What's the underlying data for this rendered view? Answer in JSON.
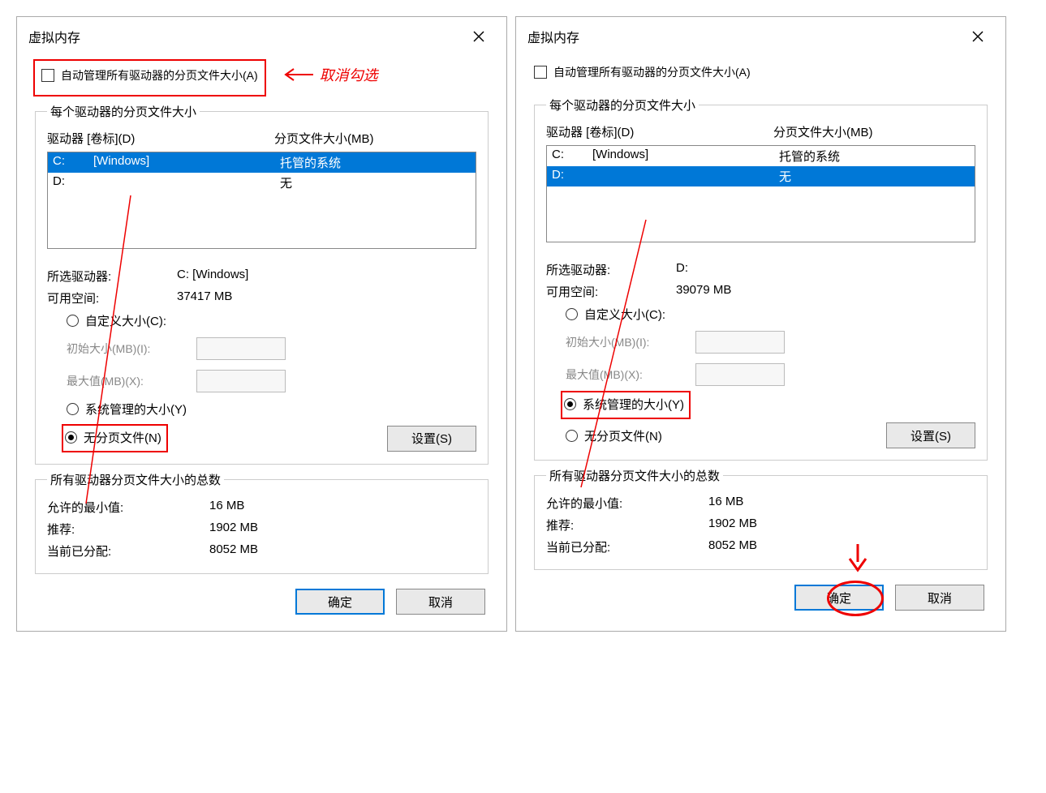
{
  "dialogs": [
    {
      "title": "虚拟内存",
      "auto_manage_label": "自动管理所有驱动器的分页文件大小(A)",
      "annot_uncheck": "取消勾选",
      "group1_legend": "每个驱动器的分页文件大小",
      "col_drive": "驱动器 [卷标](D)",
      "col_size": "分页文件大小(MB)",
      "drives": [
        {
          "letter": "C:",
          "label": "[Windows]",
          "size": "托管的系统",
          "selected": true
        },
        {
          "letter": "D:",
          "label": "",
          "size": "无",
          "selected": false
        }
      ],
      "sel_drive_label": "所选驱动器:",
      "sel_drive_value": "C:  [Windows]",
      "free_space_label": "可用空间:",
      "free_space_value": "37417 MB",
      "radio_custom": "自定义大小(C):",
      "initial_label": "初始大小(MB)(I):",
      "max_label": "最大值(MB)(X):",
      "radio_system": "系统管理的大小(Y)",
      "radio_none": "无分页文件(N)",
      "selected_radio": "none",
      "set_btn": "设置(S)",
      "group2_legend": "所有驱动器分页文件大小的总数",
      "min_label": "允许的最小值:",
      "min_value": "16 MB",
      "rec_label": "推荐:",
      "rec_value": "1902 MB",
      "cur_label": "当前已分配:",
      "cur_value": "8052 MB",
      "ok_btn": "确定",
      "cancel_btn": "取消",
      "highlight_checkbox": true,
      "highlight_none_radio": true,
      "highlight_system_radio": false,
      "circle_ok": false,
      "arrow_to_ok": false
    },
    {
      "title": "虚拟内存",
      "auto_manage_label": "自动管理所有驱动器的分页文件大小(A)",
      "annot_uncheck": "",
      "group1_legend": "每个驱动器的分页文件大小",
      "col_drive": "驱动器 [卷标](D)",
      "col_size": "分页文件大小(MB)",
      "drives": [
        {
          "letter": "C:",
          "label": "[Windows]",
          "size": "托管的系统",
          "selected": false
        },
        {
          "letter": "D:",
          "label": "",
          "size": "无",
          "selected": true
        }
      ],
      "sel_drive_label": "所选驱动器:",
      "sel_drive_value": "D:",
      "free_space_label": "可用空间:",
      "free_space_value": "39079 MB",
      "radio_custom": "自定义大小(C):",
      "initial_label": "初始大小(MB)(I):",
      "max_label": "最大值(MB)(X):",
      "radio_system": "系统管理的大小(Y)",
      "radio_none": "无分页文件(N)",
      "selected_radio": "system",
      "set_btn": "设置(S)",
      "group2_legend": "所有驱动器分页文件大小的总数",
      "min_label": "允许的最小值:",
      "min_value": "16 MB",
      "rec_label": "推荐:",
      "rec_value": "1902 MB",
      "cur_label": "当前已分配:",
      "cur_value": "8052 MB",
      "ok_btn": "确定",
      "cancel_btn": "取消",
      "highlight_checkbox": false,
      "highlight_none_radio": false,
      "highlight_system_radio": true,
      "circle_ok": true,
      "arrow_to_ok": true
    }
  ]
}
